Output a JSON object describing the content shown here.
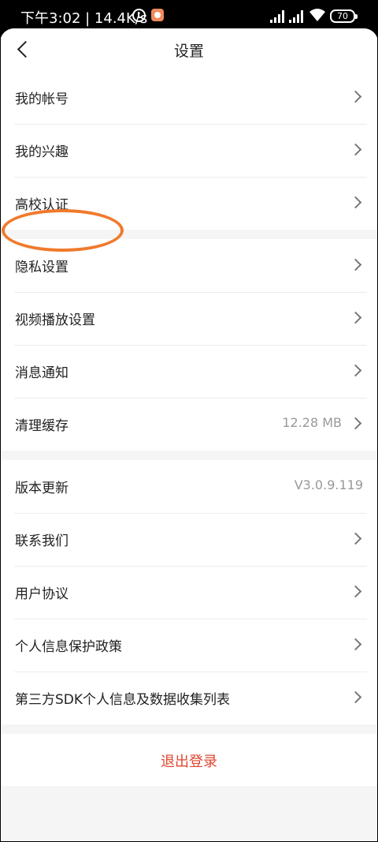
{
  "status_bar": {
    "time_and_speed": "下午3:02 | 14.4K/s",
    "battery": "70"
  },
  "header": {
    "title": "设置"
  },
  "groups": [
    {
      "items": [
        {
          "label": "我的帐号"
        },
        {
          "label": "我的兴趣"
        },
        {
          "label": "高校认证"
        }
      ]
    },
    {
      "items": [
        {
          "label": "隐私设置"
        },
        {
          "label": "视频播放设置"
        },
        {
          "label": "消息通知"
        },
        {
          "label": "清理缓存",
          "value": "12.28 MB"
        }
      ]
    },
    {
      "items": [
        {
          "label": "版本更新",
          "value": "V3.0.9.119"
        },
        {
          "label": "联系我们"
        },
        {
          "label": "用户协议"
        },
        {
          "label": "个人信息保护政策"
        },
        {
          "label": "第三方SDK个人信息及数据收集列表"
        }
      ]
    }
  ],
  "logout_label": "退出登录",
  "colors": {
    "accent_red": "#e0452f",
    "highlight_orange": "#f07a2c"
  }
}
